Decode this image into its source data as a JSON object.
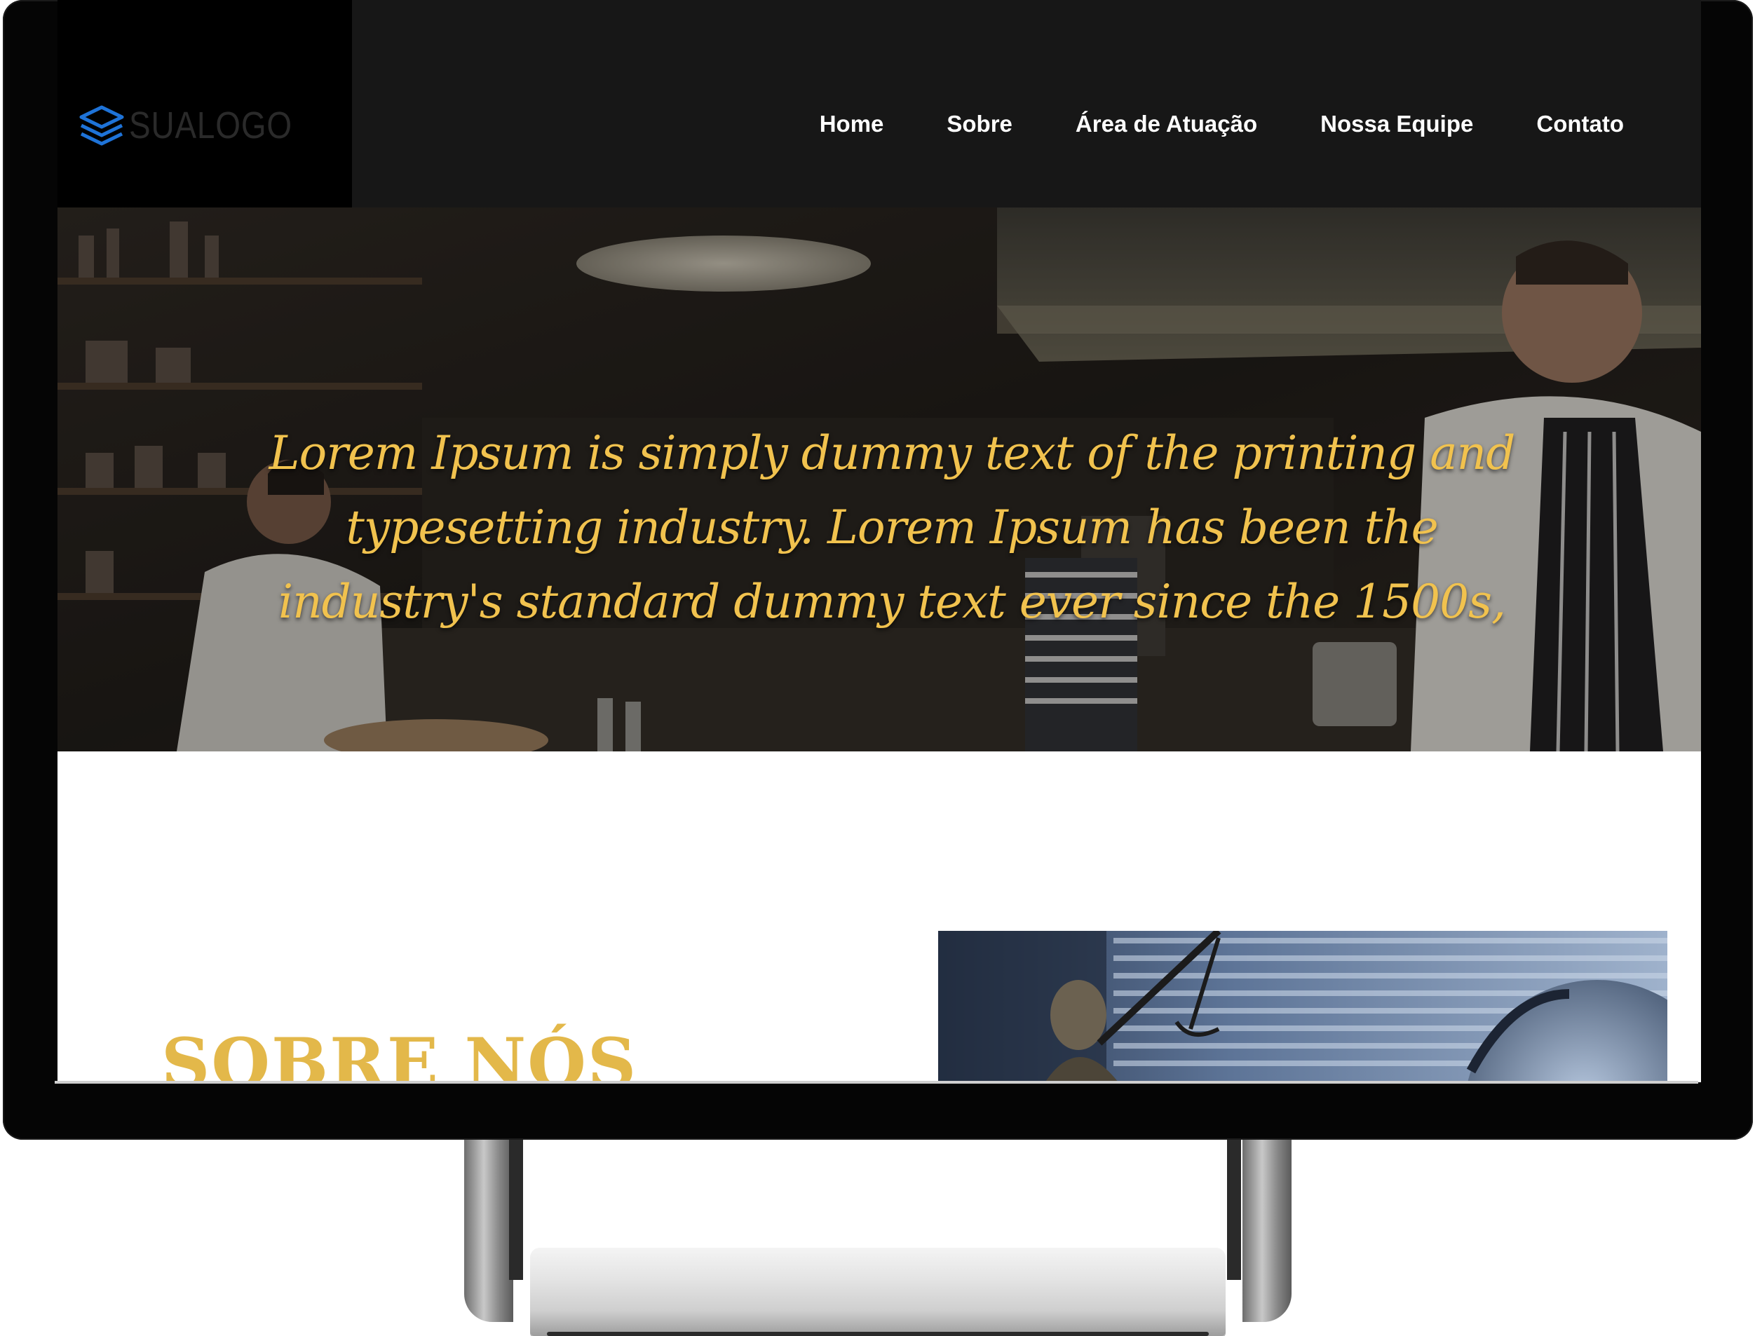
{
  "site": {
    "logo_text": "SUALOGO",
    "logo_icon": "layers-icon",
    "nav": [
      {
        "label": "Home"
      },
      {
        "label": "Sobre"
      },
      {
        "label": "Área de Atuação"
      },
      {
        "label": "Nossa Equipe"
      },
      {
        "label": "Contato"
      }
    ],
    "hero": {
      "text": "Lorem Ipsum is simply dummy text of the printing and typesetting industry. Lorem Ipsum has been the industry's standard dummy text ever since the 1500s,"
    },
    "about": {
      "title": "SOBRE NÓS"
    }
  },
  "colors": {
    "accent": "#e3b84a",
    "hero_text": "#f1c24e",
    "logo_icon": "#1e73d8",
    "nav_bg": "#171717",
    "frame": "#050505"
  }
}
